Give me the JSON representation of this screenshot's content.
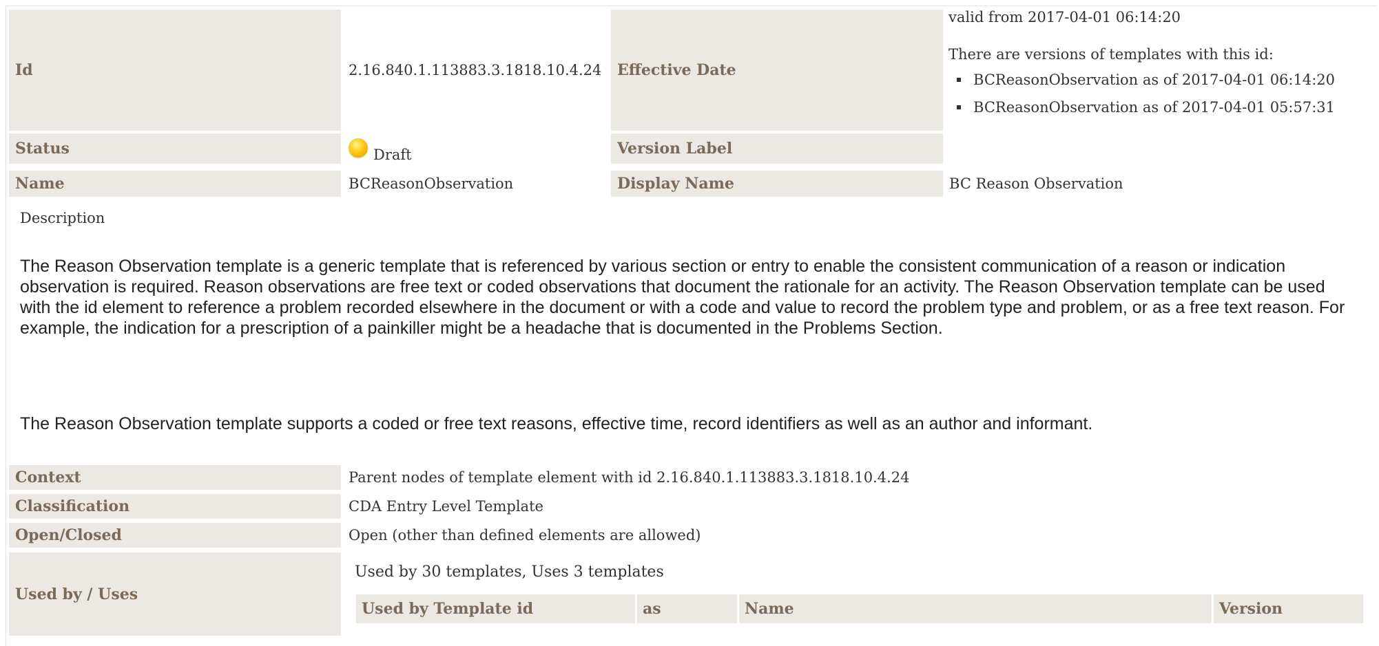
{
  "meta": {
    "id_label": "Id",
    "id_value": "2.16.840.1.113883.3.1818.10.4.24",
    "effective_date_label": "Effective Date",
    "valid_from": "valid from 2017-04-01 06:14:20",
    "versions_intro": "There are versions of templates with this id:",
    "versions": [
      "BCReasonObservation as of 2017-04-01 06:14:20",
      "BCReasonObservation as of 2017-04-01 05:57:31"
    ],
    "status_label": "Status",
    "status_value": "Draft",
    "status_color": "#ffd21f",
    "version_label_label": "Version Label",
    "version_label_value": "",
    "name_label": "Name",
    "name_value": "BCReasonObservation",
    "display_name_label": "Display Name",
    "display_name_value": "BC Reason Observation"
  },
  "description": {
    "title": "Description",
    "paragraph1": "The Reason Observation template is a generic template that is referenced by various section or entry to enable the consistent communication of a reason or indication observation is required. Reason observations are free text or coded observations that document the rationale for an activity. The Reason Observation template can be used with the id element to reference a problem recorded elsewhere in the document or with a code and value to record the problem type and problem, or as a free text reason. For example, the indication for a prescription of a painkiller might be a headache that is documented in the Problems Section.",
    "paragraph2": "The Reason Observation template supports a coded or free text reasons, effective time, record identifiers as well as an author and informant."
  },
  "details": {
    "context_label": "Context",
    "context_value": "Parent nodes of template element with id 2.16.840.1.113883.3.1818.10.4.24",
    "classification_label": "Classification",
    "classification_value": "CDA Entry Level Template",
    "open_closed_label": "Open/Closed",
    "open_closed_value": "Open (other than defined elements are allowed)",
    "used_by_label": "Used by / Uses",
    "used_by_summary": "Used by 30 templates, Uses 3 templates",
    "used_by_columns": [
      "Used by Template id",
      "as",
      "Name",
      "Version"
    ]
  },
  "colors": {
    "label_bg": "#ece9e4",
    "label_text": "#7a6a57"
  }
}
